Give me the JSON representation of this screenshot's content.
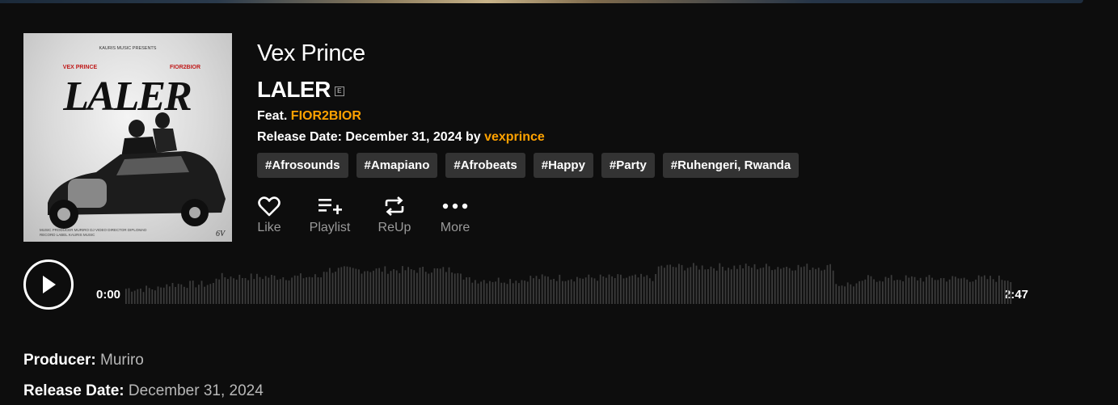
{
  "song": {
    "artist": "Vex Prince",
    "title": "LALER",
    "explicit_badge": "E",
    "feat_label": "Feat.",
    "feat_artist": "FIOR2BIOR",
    "release_label": "Release Date: December 31, 2024 by",
    "uploader": "vexprince"
  },
  "cover": {
    "presents": "KAURIS MUSIC PRESENTS",
    "artist_left": "VEX PRINCE",
    "artist_right": "FIOR2BIOR",
    "title": "LALER",
    "credits_line1": "MUSIC PRODUCER MURIRO DJ   VIDEO DIRECTOR DIPLOMAD",
    "credits_line2": "RECORD LABEL KAURIS MUSIC",
    "monogram": "6V"
  },
  "tags": [
    "#Afrosounds",
    "#Amapiano",
    "#Afrobeats",
    "#Happy",
    "#Party",
    "#Ruhengeri, Rwanda"
  ],
  "actions": {
    "like": "Like",
    "playlist": "Playlist",
    "reup": "ReUp",
    "more": "More"
  },
  "player": {
    "current_time": "0:00",
    "duration": "2:47",
    "progress": 0
  },
  "meta": {
    "producer_label": "Producer:",
    "producer_value": "Muriro",
    "release_label": "Release Date:",
    "release_value": "December 31, 2024"
  },
  "colors": {
    "background": "#0d0d0d",
    "accent": "#ffa200",
    "tag_bg": "#333333",
    "muted": "#9a9a9a",
    "wave": "#3b3b3b"
  }
}
